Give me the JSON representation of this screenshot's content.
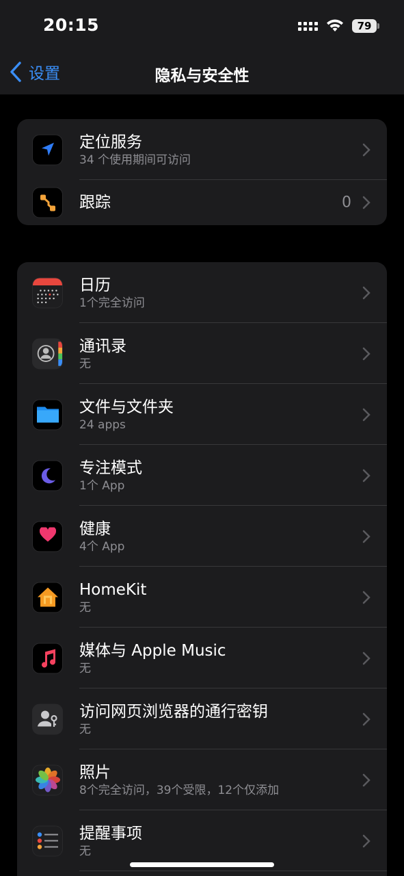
{
  "status": {
    "time": "20:15",
    "battery": "79"
  },
  "nav": {
    "back_label": "设置",
    "title": "隐私与安全性"
  },
  "group1": [
    {
      "title": "定位服务",
      "subtitle": "34 个使用期间可访问",
      "icon": "location-arrow-icon"
    },
    {
      "title": "跟踪",
      "value": "0",
      "icon": "tracking-icon"
    }
  ],
  "group2": [
    {
      "title": "日历",
      "subtitle": "1个完全访问",
      "icon": "calendar-icon"
    },
    {
      "title": "通讯录",
      "subtitle": "无",
      "icon": "contacts-icon"
    },
    {
      "title": "文件与文件夹",
      "subtitle": "24 apps",
      "icon": "folder-icon"
    },
    {
      "title": "专注模式",
      "subtitle": "1个 App",
      "icon": "moon-icon"
    },
    {
      "title": "健康",
      "subtitle": "4个 App",
      "icon": "heart-icon"
    },
    {
      "title": "HomeKit",
      "subtitle": "无",
      "icon": "home-icon"
    },
    {
      "title": "媒体与 Apple Music",
      "subtitle": "无",
      "icon": "music-note-icon"
    },
    {
      "title": "访问网页浏览器的通行密钥",
      "subtitle": "无",
      "icon": "passkey-icon"
    },
    {
      "title": "照片",
      "subtitle": "8个完全访问，39个受限，12个仅添加",
      "icon": "photos-icon"
    },
    {
      "title": "提醒事项",
      "subtitle": "无",
      "icon": "reminders-icon"
    }
  ],
  "colors": {
    "accent": "#3a8ef6",
    "background": "#000000",
    "cell": "#1c1c1e",
    "secondary_text": "#8e8e93"
  }
}
